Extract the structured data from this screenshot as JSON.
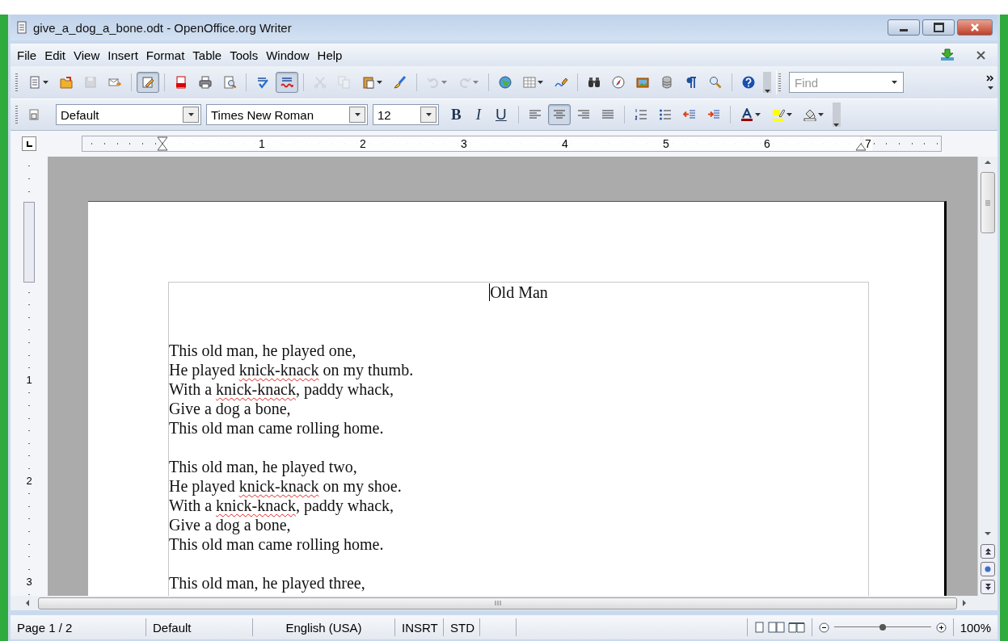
{
  "window": {
    "title": "give_a_dog_a_bone.odt - OpenOffice.org Writer"
  },
  "menu": [
    {
      "label": "File"
    },
    {
      "label": "Edit"
    },
    {
      "label": "View"
    },
    {
      "label": "Insert"
    },
    {
      "label": "Format"
    },
    {
      "label": "Table"
    },
    {
      "label": "Tools"
    },
    {
      "label": "Window"
    },
    {
      "label": "Help"
    }
  ],
  "standard_toolbar": {
    "items": [
      {
        "kind": "button",
        "selected": false,
        "disabled": false,
        "menu": true
      },
      {
        "kind": "button",
        "selected": false,
        "disabled": false,
        "menu": false
      },
      {
        "kind": "button",
        "selected": false,
        "disabled": true,
        "menu": false
      },
      {
        "kind": "button",
        "selected": false,
        "disabled": false,
        "menu": false
      },
      {
        "kind": "separator"
      },
      {
        "kind": "button",
        "selected": true,
        "disabled": false,
        "menu": false
      },
      {
        "kind": "separator"
      },
      {
        "kind": "button",
        "selected": false,
        "disabled": false,
        "menu": false
      },
      {
        "kind": "button",
        "selected": false,
        "disabled": false,
        "menu": false
      },
      {
        "kind": "button",
        "selected": false,
        "disabled": false,
        "menu": false
      },
      {
        "kind": "separator"
      },
      {
        "kind": "button",
        "selected": false,
        "disabled": false,
        "menu": false
      },
      {
        "kind": "button",
        "selected": true,
        "disabled": false,
        "menu": false
      },
      {
        "kind": "separator"
      },
      {
        "kind": "button",
        "selected": false,
        "disabled": true,
        "menu": false
      },
      {
        "kind": "button",
        "selected": false,
        "disabled": true,
        "menu": false
      },
      {
        "kind": "button",
        "selected": false,
        "disabled": false,
        "menu": true
      },
      {
        "kind": "button",
        "selected": false,
        "disabled": false,
        "menu": false
      },
      {
        "kind": "separator"
      },
      {
        "kind": "button",
        "selected": false,
        "disabled": true,
        "menu": true
      },
      {
        "kind": "button",
        "selected": false,
        "disabled": true,
        "menu": true
      },
      {
        "kind": "separator"
      },
      {
        "kind": "button",
        "selected": false,
        "disabled": false,
        "menu": false
      },
      {
        "kind": "button",
        "selected": false,
        "disabled": false,
        "menu": true
      },
      {
        "kind": "button",
        "selected": false,
        "disabled": false,
        "menu": false
      },
      {
        "kind": "separator"
      },
      {
        "kind": "button",
        "selected": false,
        "disabled": false,
        "menu": false
      },
      {
        "kind": "button",
        "selected": false,
        "disabled": false,
        "menu": false
      },
      {
        "kind": "button",
        "selected": false,
        "disabled": false,
        "menu": false
      },
      {
        "kind": "button",
        "selected": false,
        "disabled": false,
        "menu": false
      },
      {
        "kind": "button",
        "selected": false,
        "disabled": false,
        "menu": false
      },
      {
        "kind": "button",
        "selected": false,
        "disabled": false,
        "menu": false
      },
      {
        "kind": "separator"
      },
      {
        "kind": "button",
        "selected": false,
        "disabled": false,
        "menu": false
      }
    ]
  },
  "find": {
    "placeholder": "Find"
  },
  "formatting_toolbar": {
    "paragraph_style": "Default",
    "font_name": "Times New Roman",
    "font_size": "12",
    "items": [
      {
        "kind": "letter",
        "label": "B",
        "selected": false
      },
      {
        "kind": "letter",
        "label": "I",
        "selected": false
      },
      {
        "kind": "letter",
        "label": "U",
        "selected": false
      },
      {
        "kind": "separator"
      },
      {
        "kind": "button",
        "selected": false,
        "menu": false
      },
      {
        "kind": "button",
        "selected": true,
        "menu": false
      },
      {
        "kind": "button",
        "selected": false,
        "menu": false
      },
      {
        "kind": "button",
        "selected": false,
        "menu": false
      },
      {
        "kind": "separator"
      },
      {
        "kind": "button",
        "selected": false,
        "menu": false
      },
      {
        "kind": "button",
        "selected": false,
        "menu": false
      },
      {
        "kind": "button",
        "selected": false,
        "menu": false
      },
      {
        "kind": "button",
        "selected": false,
        "menu": false
      },
      {
        "kind": "separator"
      },
      {
        "kind": "button",
        "selected": false,
        "menu": true
      },
      {
        "kind": "button",
        "selected": false,
        "menu": true
      },
      {
        "kind": "button",
        "selected": false,
        "menu": true
      }
    ]
  },
  "ruler": {
    "marks": [
      "1",
      "2",
      "3",
      "4",
      "5",
      "6",
      "7"
    ]
  },
  "vertical_ruler": {
    "marks": [
      "1",
      "2",
      "3"
    ]
  },
  "document": {
    "header": "Old Man",
    "stanzas": [
      {
        "lines": [
          [
            {
              "text": "This old man, he played one,",
              "misspelled": false
            }
          ],
          [
            {
              "text": "He played ",
              "misspelled": false
            },
            {
              "text": "knick-knack",
              "misspelled": true
            },
            {
              "text": " on my thumb.",
              "misspelled": false
            }
          ],
          [
            {
              "text": "With a ",
              "misspelled": false
            },
            {
              "text": "knick-knack",
              "misspelled": true
            },
            {
              "text": ", paddy whack,",
              "misspelled": false
            }
          ],
          [
            {
              "text": "Give a dog a bone,",
              "misspelled": false
            }
          ],
          [
            {
              "text": "This old man came rolling home.",
              "misspelled": false
            }
          ]
        ]
      },
      {
        "lines": [
          [
            {
              "text": "This old man, he played two,",
              "misspelled": false
            }
          ],
          [
            {
              "text": "He played ",
              "misspelled": false
            },
            {
              "text": "knick-knack",
              "misspelled": true
            },
            {
              "text": " on my shoe.",
              "misspelled": false
            }
          ],
          [
            {
              "text": "With a ",
              "misspelled": false
            },
            {
              "text": "knick-knack",
              "misspelled": true
            },
            {
              "text": ", paddy whack,",
              "misspelled": false
            }
          ],
          [
            {
              "text": "Give a dog a bone,",
              "misspelled": false
            }
          ],
          [
            {
              "text": "This old man came rolling home.",
              "misspelled": false
            }
          ]
        ]
      },
      {
        "lines": [
          [
            {
              "text": "This old man, he played three,",
              "misspelled": false
            }
          ]
        ]
      }
    ]
  },
  "status_bar": {
    "page": "Page 1 / 2",
    "page_style": "Default",
    "language": "English (USA)",
    "insert_mode": "INSRT",
    "selection_mode": "STD",
    "zoom_slider": {
      "level": 0.5
    },
    "zoom": "100%"
  }
}
